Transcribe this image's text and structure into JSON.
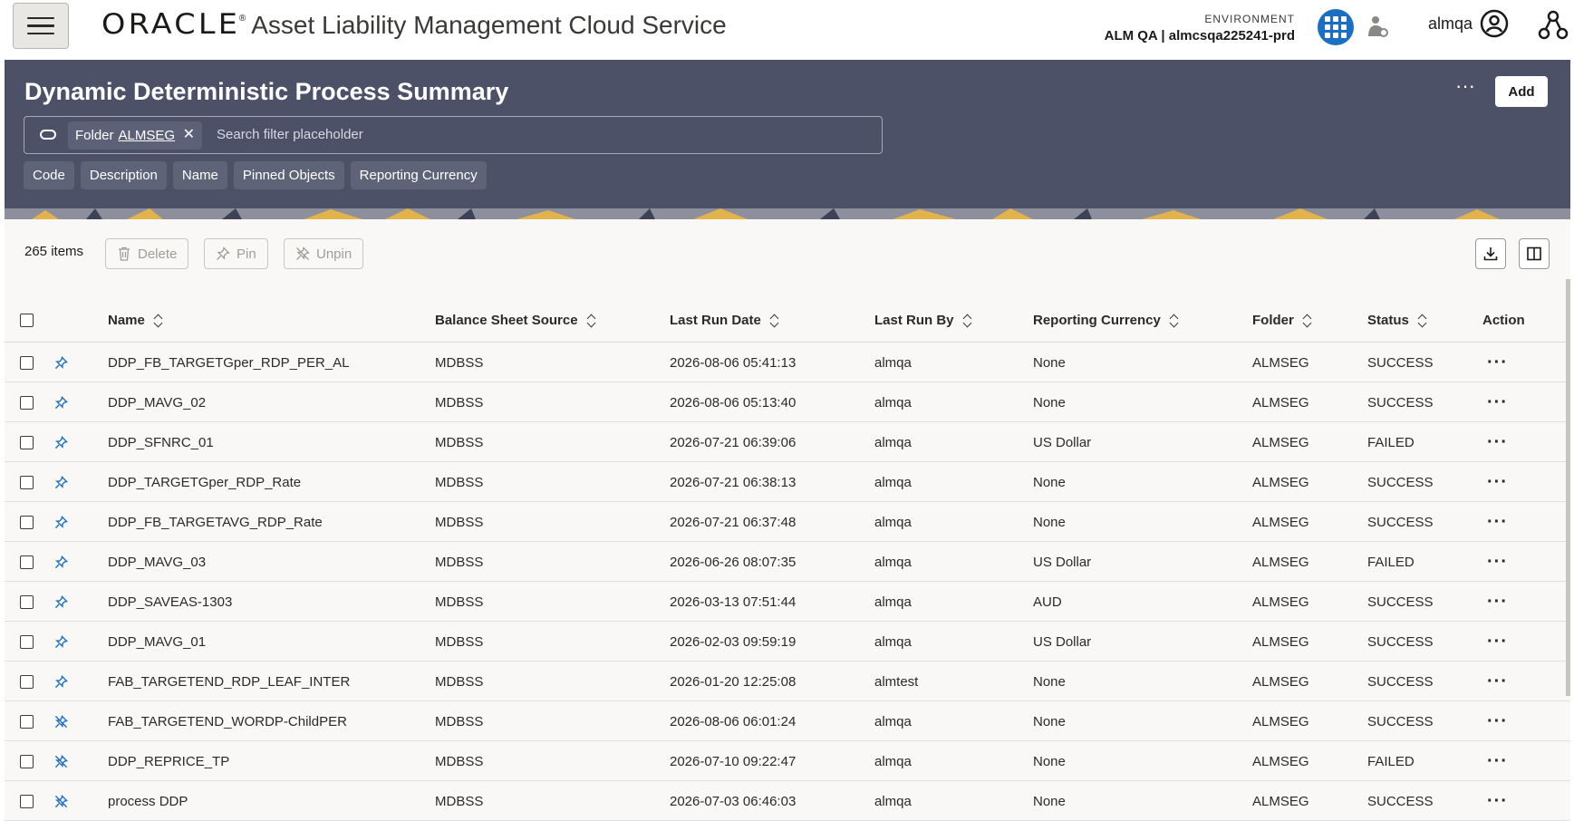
{
  "header": {
    "menu_label": "Menu",
    "brand_logo": "ORACLE",
    "brand_reg": "®",
    "app_title": "Asset Liability Management Cloud Service",
    "environment_label": "ENVIRONMENT",
    "environment_value": "ALM QA | almcsqa225241-prd",
    "user_name": "almqa",
    "icons": [
      "hamburger-icon",
      "apps-grid-icon",
      "worker-icon",
      "user-avatar-icon",
      "org-chart-icon"
    ],
    "apps_button_color": "#1b6fc2"
  },
  "page": {
    "title": "Dynamic Deterministic Process Summary",
    "more_label": "···",
    "add_label": "Add",
    "hero_color": "#4d5167"
  },
  "search": {
    "chip_label": "Folder",
    "chip_value": "ALMSEG",
    "chip_close": "✕",
    "placeholder": "Search filter placeholder"
  },
  "facets": [
    "Code",
    "Description",
    "Name",
    "Pinned Objects",
    "Reporting Currency"
  ],
  "toolbar": {
    "items_count": "265 items",
    "delete_label": "Delete",
    "pin_label": "Pin",
    "unpin_label": "Unpin",
    "download_icon": "download-icon",
    "columns_icon": "columns-icon"
  },
  "table": {
    "columns": {
      "name": "Name",
      "source": "Balance Sheet Source",
      "last_run_date": "Last Run Date",
      "last_run_by": "Last Run By",
      "currency": "Reporting Currency",
      "folder": "Folder",
      "status": "Status",
      "action": "Action"
    },
    "rows": [
      {
        "pinned": true,
        "name": "DDP_FB_TARGETGper_RDP_PER_AL",
        "source": "MDBSS",
        "date": "2026-08-06 05:41:13",
        "by": "almqa",
        "currency": "None",
        "folder": "ALMSEG",
        "status": "SUCCESS",
        "action": "···"
      },
      {
        "pinned": true,
        "name": "DDP_MAVG_02",
        "source": "MDBSS",
        "date": "2026-08-06 05:13:40",
        "by": "almqa",
        "currency": "None",
        "folder": "ALMSEG",
        "status": "SUCCESS",
        "action": "···"
      },
      {
        "pinned": true,
        "name": "DDP_SFNRC_01",
        "source": "MDBSS",
        "date": "2026-07-21 06:39:06",
        "by": "almqa",
        "currency": "US Dollar",
        "folder": "ALMSEG",
        "status": "FAILED",
        "action": "···"
      },
      {
        "pinned": true,
        "name": "DDP_TARGETGper_RDP_Rate",
        "source": "MDBSS",
        "date": "2026-07-21 06:38:13",
        "by": "almqa",
        "currency": "None",
        "folder": "ALMSEG",
        "status": "SUCCESS",
        "action": "···"
      },
      {
        "pinned": true,
        "name": "DDP_FB_TARGETAVG_RDP_Rate",
        "source": "MDBSS",
        "date": "2026-07-21 06:37:48",
        "by": "almqa",
        "currency": "None",
        "folder": "ALMSEG",
        "status": "SUCCESS",
        "action": "···"
      },
      {
        "pinned": true,
        "name": "DDP_MAVG_03",
        "source": "MDBSS",
        "date": "2026-06-26 08:07:35",
        "by": "almqa",
        "currency": "US Dollar",
        "folder": "ALMSEG",
        "status": "FAILED",
        "action": "···"
      },
      {
        "pinned": true,
        "name": "DDP_SAVEAS-1303",
        "source": "MDBSS",
        "date": "2026-03-13 07:51:44",
        "by": "almqa",
        "currency": "AUD",
        "folder": "ALMSEG",
        "status": "SUCCESS",
        "action": "···"
      },
      {
        "pinned": true,
        "name": "DDP_MAVG_01",
        "source": "MDBSS",
        "date": "2026-02-03 09:59:19",
        "by": "almqa",
        "currency": "US Dollar",
        "folder": "ALMSEG",
        "status": "SUCCESS",
        "action": "···"
      },
      {
        "pinned": true,
        "name": "FAB_TARGETEND_RDP_LEAF_INTER",
        "source": "MDBSS",
        "date": "2026-01-20 12:25:08",
        "by": "almtest",
        "currency": "None",
        "folder": "ALMSEG",
        "status": "SUCCESS",
        "action": "···"
      },
      {
        "pinned": false,
        "name": "FAB_TARGETEND_WORDP-ChildPER",
        "source": "MDBSS",
        "date": "2026-08-06 06:01:24",
        "by": "almqa",
        "currency": "None",
        "folder": "ALMSEG",
        "status": "SUCCESS",
        "action": "···"
      },
      {
        "pinned": false,
        "name": "DDP_REPRICE_TP",
        "source": "MDBSS",
        "date": "2026-07-10 09:22:47",
        "by": "almqa",
        "currency": "None",
        "folder": "ALMSEG",
        "status": "FAILED",
        "action": "···"
      },
      {
        "pinned": false,
        "name": "process DDP",
        "source": "MDBSS",
        "date": "2026-07-03 06:46:03",
        "by": "almqa",
        "currency": "None",
        "folder": "ALMSEG",
        "status": "SUCCESS",
        "action": "···"
      }
    ]
  }
}
